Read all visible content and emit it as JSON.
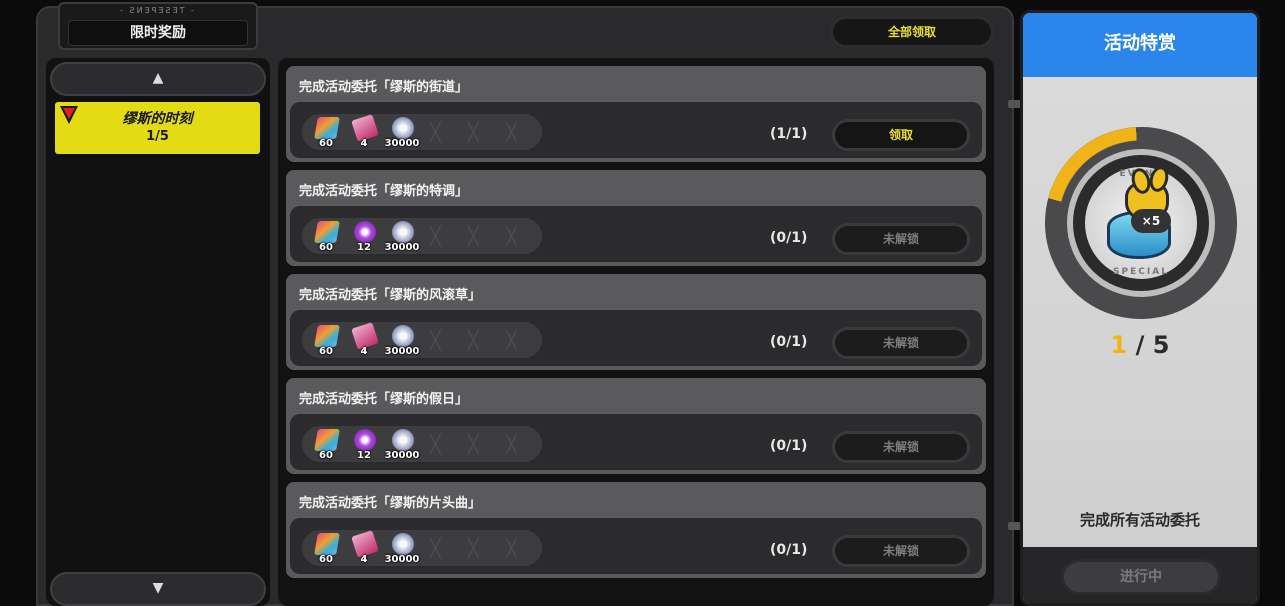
{
  "header": {
    "subtitle": "- ƧИƎꟼƎƧƎƬ -",
    "title": "限时奖励",
    "claim_all": "全部领取"
  },
  "sidebar": {
    "up_arrow": "▲",
    "down_arrow": "▼",
    "tabs": [
      {
        "name": "缪斯的时刻",
        "count": "1/5",
        "alert": true
      }
    ]
  },
  "tasks": [
    {
      "title": "完成活动委托「缪斯的街道」",
      "rewards": [
        {
          "icon": "ticket-icon",
          "qty": "60"
        },
        {
          "icon": "film-icon",
          "qty": "4"
        },
        {
          "icon": "coin-icon",
          "qty": "30000"
        }
      ],
      "progress": "(1/1)",
      "button": "领取",
      "state": "claimable"
    },
    {
      "title": "完成活动委托「缪斯的特调」",
      "rewards": [
        {
          "icon": "ticket-icon",
          "qty": "60"
        },
        {
          "icon": "gear-icon",
          "qty": "12"
        },
        {
          "icon": "coin-icon",
          "qty": "30000"
        }
      ],
      "progress": "(0/1)",
      "button": "未解锁",
      "state": "locked"
    },
    {
      "title": "完成活动委托「缪斯的风滚草」",
      "rewards": [
        {
          "icon": "ticket-icon",
          "qty": "60"
        },
        {
          "icon": "film-icon",
          "qty": "4"
        },
        {
          "icon": "coin-icon",
          "qty": "30000"
        }
      ],
      "progress": "(0/1)",
      "button": "未解锁",
      "state": "locked"
    },
    {
      "title": "完成活动委托「缪斯的假日」",
      "rewards": [
        {
          "icon": "ticket-icon",
          "qty": "60"
        },
        {
          "icon": "gear-icon",
          "qty": "12"
        },
        {
          "icon": "coin-icon",
          "qty": "30000"
        }
      ],
      "progress": "(0/1)",
      "button": "未解锁",
      "state": "locked"
    },
    {
      "title": "完成活动委托「缪斯的片头曲」",
      "rewards": [
        {
          "icon": "ticket-icon",
          "qty": "60"
        },
        {
          "icon": "film-icon",
          "qty": "4"
        },
        {
          "icon": "coin-icon",
          "qty": "30000"
        }
      ],
      "progress": "(0/1)",
      "button": "未解锁",
      "state": "locked"
    }
  ],
  "special": {
    "title": "活动特赏",
    "badge_top": "EVENT",
    "badge_bottom": "SPECIAL",
    "multiplier": "×5",
    "progress_current": "1",
    "progress_total": " / 5",
    "progress_fraction": 0.2,
    "description": "完成所有活动委托",
    "status": "进行中",
    "accent": "#f0b419",
    "header_color": "#2a86ea"
  }
}
